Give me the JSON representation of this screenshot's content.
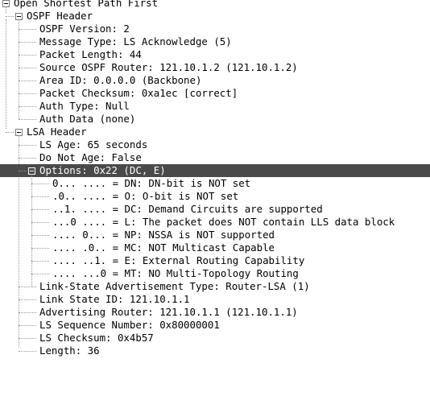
{
  "tree": {
    "root": {
      "label": "Open Shortest Path First",
      "expanded": true
    },
    "ospf_header": {
      "label": "OSPF Header",
      "expanded": true,
      "fields": [
        "OSPF Version: 2",
        "Message Type: LS Acknowledge (5)",
        "Packet Length: 44",
        "Source OSPF Router: 121.10.1.2 (121.10.1.2)",
        "Area ID: 0.0.0.0 (Backbone)",
        "Packet Checksum: 0xa1ec [correct]",
        "Auth Type: Null",
        "Auth Data (none)"
      ]
    },
    "lsa_header": {
      "label": "LSA Header",
      "expanded": true,
      "fields_before": [
        "LS Age: 65 seconds",
        "Do Not Age: False"
      ],
      "options": {
        "label": "Options: 0x22 (DC, E)",
        "expanded": true,
        "selected": true,
        "bits": [
          "0... .... = DN: DN-bit is NOT set",
          ".0.. .... = O: O-bit is NOT set",
          "..1. .... = DC: Demand Circuits are supported",
          "...0 .... = L: The packet does NOT contain LLS data block",
          ".... 0... = NP: NSSA is NOT supported",
          ".... .0.. = MC: NOT Multicast Capable",
          ".... ..1. = E: External Routing Capability",
          ".... ...0 = MT: NO Multi-Topology Routing"
        ]
      },
      "fields_after": [
        "Link-State Advertisement Type: Router-LSA (1)",
        "Link State ID: 121.10.1.1",
        "Advertising Router: 121.10.1.1 (121.10.1.1)",
        "LS Sequence Number: 0x80000001",
        "LS Checksum: 0x4b57",
        "Length: 36"
      ]
    }
  }
}
